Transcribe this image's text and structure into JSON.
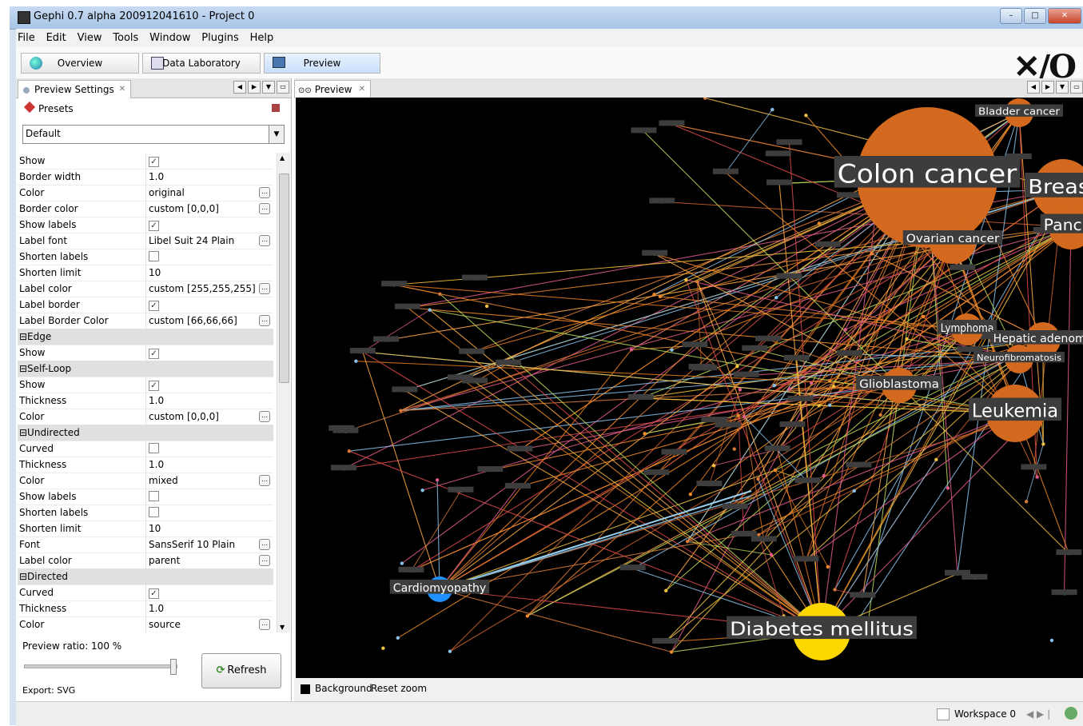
{
  "window": {
    "title": "Gephi 0.7 alpha 200912041610 - Project 0"
  },
  "menu": [
    "File",
    "Edit",
    "View",
    "Tools",
    "Window",
    "Plugins",
    "Help"
  ],
  "workspaces": {
    "overview": "Overview",
    "data_lab": "Data Laboratory",
    "preview": "Preview"
  },
  "left_panel": {
    "tab": "Preview Settings",
    "presets_label": "Presets",
    "preset_value": "Default",
    "rows": [
      {
        "type": "prop",
        "key": "Show",
        "check": true
      },
      {
        "type": "prop",
        "key": "Border width",
        "value": "1.0"
      },
      {
        "type": "prop",
        "key": "Color",
        "value": "original",
        "dots": true
      },
      {
        "type": "prop",
        "key": "Border color",
        "value": "custom [0,0,0]",
        "dots": true
      },
      {
        "type": "prop",
        "key": "Show labels",
        "check": true
      },
      {
        "type": "prop",
        "key": "Label font",
        "value": "Libel Suit 24 Plain",
        "dots": true
      },
      {
        "type": "prop",
        "key": "Shorten labels",
        "check": false
      },
      {
        "type": "prop",
        "key": "Shorten limit",
        "value": "10"
      },
      {
        "type": "prop",
        "key": "Label color",
        "value": "custom [255,255,255]",
        "dots": true
      },
      {
        "type": "prop",
        "key": "Label border",
        "check": true
      },
      {
        "type": "prop",
        "key": "Label Border Color",
        "value": "custom [66,66,66]",
        "dots": true
      },
      {
        "type": "cat",
        "key": "Edge"
      },
      {
        "type": "prop",
        "key": "Show",
        "check": true
      },
      {
        "type": "cat",
        "key": "Self-Loop"
      },
      {
        "type": "prop",
        "key": "Show",
        "check": true
      },
      {
        "type": "prop",
        "key": "Thickness",
        "value": "1.0"
      },
      {
        "type": "prop",
        "key": "Color",
        "value": "custom [0,0,0]",
        "dots": true
      },
      {
        "type": "cat",
        "key": "Undirected"
      },
      {
        "type": "prop",
        "key": "Curved",
        "check": false
      },
      {
        "type": "prop",
        "key": "Thickness",
        "value": "1.0"
      },
      {
        "type": "prop",
        "key": "Color",
        "value": "mixed",
        "dots": true
      },
      {
        "type": "prop",
        "key": "Show labels",
        "check": false
      },
      {
        "type": "prop",
        "key": "Shorten labels",
        "check": false
      },
      {
        "type": "prop",
        "key": "Shorten limit",
        "value": "10"
      },
      {
        "type": "prop",
        "key": "Font",
        "value": "SansSerif 10 Plain",
        "dots": true
      },
      {
        "type": "prop",
        "key": "Label color",
        "value": "parent",
        "dots": true
      },
      {
        "type": "cat",
        "key": "Directed"
      },
      {
        "type": "prop",
        "key": "Curved",
        "check": true
      },
      {
        "type": "prop",
        "key": "Thickness",
        "value": "1.0"
      },
      {
        "type": "prop",
        "key": "Color",
        "value": "source",
        "dots": true
      }
    ],
    "ratio_label": "Preview ratio:  100 %",
    "refresh": "Refresh",
    "export": "Export:   SVG"
  },
  "right_panel": {
    "tab": "Preview",
    "background": "Background",
    "reset_zoom": "Reset zoom"
  },
  "graph": {
    "big_labels": [
      {
        "text": "Colon cancer",
        "color": "#d2691e"
      },
      {
        "text": "Breast",
        "color": "#d2691e"
      },
      {
        "text": "Pancre",
        "color": "#d2691e"
      },
      {
        "text": "Bladder cancer",
        "color": "#d2691e"
      },
      {
        "text": "Ovarian cancer",
        "color": "#d2691e"
      },
      {
        "text": "Lymphoma",
        "color": "#d2691e"
      },
      {
        "text": "Hepatic adenoma",
        "color": "#d2691e"
      },
      {
        "text": "Neurofibromatosis",
        "color": "#d2691e"
      },
      {
        "text": "Glioblastoma",
        "color": "#d2691e"
      },
      {
        "text": "Leukemia",
        "color": "#d2691e"
      },
      {
        "text": "Cardiomyopathy",
        "color": "#1e90ff"
      },
      {
        "text": "Diabetes mellitus",
        "color": "#ffd700"
      }
    ]
  },
  "status": {
    "workspace": "Workspace 0"
  }
}
